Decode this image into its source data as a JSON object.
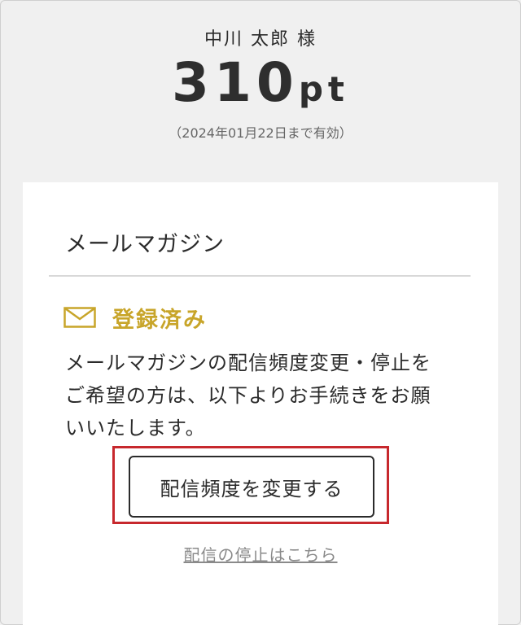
{
  "header": {
    "user_name": "中川 太郎 様",
    "points_value": "310",
    "points_unit": "pt",
    "expiry": "（2024年01月22日まで有効）"
  },
  "newsletter": {
    "title": "メールマガジン",
    "status_icon": "mail-icon",
    "status_label": "登録済み",
    "description": "メールマガジンの配信頻度変更・停止をご希望の方は、以下よりお手続きをお願いいたします。",
    "change_button_label": "配信頻度を変更する",
    "stop_link_label": "配信の停止はこちら"
  },
  "colors": {
    "accent_gold": "#c8a52a",
    "highlight_red": "#c7282d",
    "link_gray": "#8a8a8a"
  }
}
